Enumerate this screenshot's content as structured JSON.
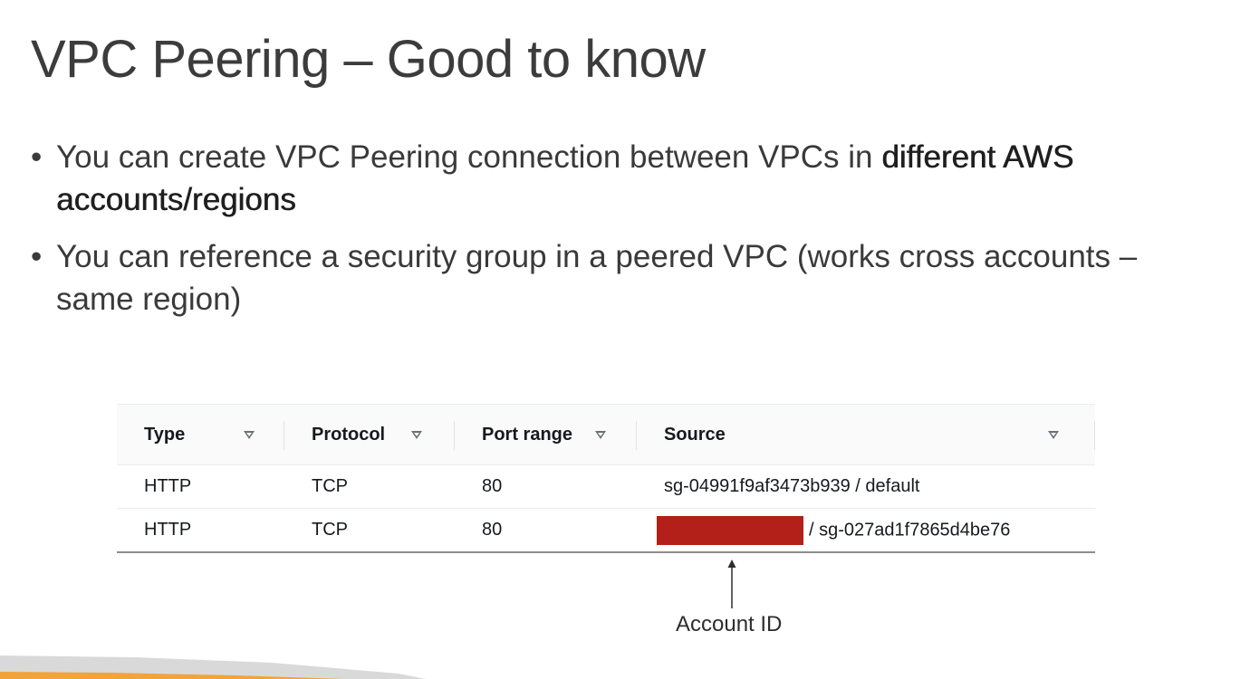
{
  "slide": {
    "title": "VPC Peering – Good to know",
    "bullets": [
      {
        "bullet_glyph": "•",
        "text_before": "You can create VPC Peering connection between VPCs in ",
        "bold_text": "different AWS accounts/regions",
        "text_after": ""
      },
      {
        "bullet_glyph": "•",
        "text_before": "You can reference a security group in a peered VPC (works cross accounts – same region)",
        "bold_text": "",
        "text_after": ""
      }
    ]
  },
  "rules_table": {
    "columns": [
      {
        "label": "Type",
        "sort_icon": "sort-down-triangle-icon"
      },
      {
        "label": "Protocol",
        "sort_icon": "sort-down-triangle-icon"
      },
      {
        "label": "Port range",
        "sort_icon": "sort-down-triangle-icon"
      },
      {
        "label": "Source",
        "sort_icon": "sort-down-triangle-icon"
      }
    ],
    "rows": [
      {
        "type": "HTTP",
        "protocol": "TCP",
        "port_range": "80",
        "source": "sg-04991f9af3473b939 / default",
        "redacted": false
      },
      {
        "type": "HTTP",
        "protocol": "TCP",
        "port_range": "80",
        "source": "/ sg-027ad1f7865d4be76",
        "redacted": true
      }
    ],
    "redaction_color": "#b32019"
  },
  "annotation": {
    "label": "Account ID",
    "arrow_icon": "arrow-up-icon"
  },
  "footer": {
    "accent_color": "#f2a33a",
    "band_color": "#d9d9d9"
  }
}
